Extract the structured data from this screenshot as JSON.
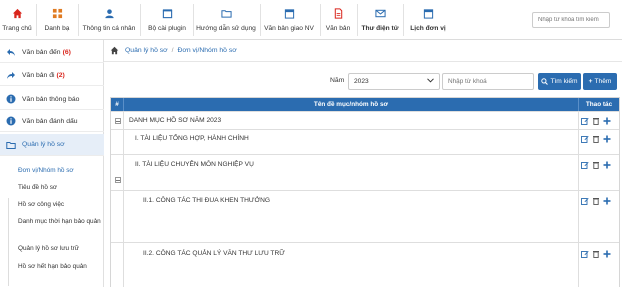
{
  "nav": {
    "items": [
      {
        "label": "Trang chủ",
        "icon": "home-icon"
      },
      {
        "label": "Danh bạ",
        "icon": "grid-icon"
      },
      {
        "label": "Thông tin cá nhân",
        "icon": "user-icon"
      },
      {
        "label": "Bộ cài plugin",
        "icon": "box-icon"
      },
      {
        "label": "Hướng dẫn sử dụng",
        "icon": "folder-icon"
      },
      {
        "label": "Văn bản giao NV",
        "icon": "calendar-icon"
      },
      {
        "label": "Văn bản",
        "icon": "document-icon"
      },
      {
        "label": "Thư điện tử",
        "icon": "mail-icon"
      },
      {
        "label": "Lịch đơn vị",
        "icon": "calendar-icon"
      }
    ],
    "search_placeholder": "Nhập từ khóa tìm kiếm"
  },
  "sidebar": {
    "items": [
      {
        "label": "Văn bản đến",
        "count": "(6)",
        "icon": "reply-icon"
      },
      {
        "label": "Văn bản đi",
        "count": "(2)",
        "icon": "forward-icon"
      },
      {
        "label": "Văn bản thông báo",
        "count": "",
        "icon": "info-icon"
      },
      {
        "label": "Văn bản đánh dấu",
        "count": "",
        "icon": "info-icon"
      },
      {
        "label": "Quản lý hồ sơ",
        "count": "",
        "icon": "folder-icon"
      }
    ],
    "sub_items": [
      "Đơn vị/Nhóm hồ sơ",
      "Tiêu đề hồ sơ",
      "Hồ sơ công việc",
      "Danh mục thời hạn bảo quản",
      "Quản lý hồ sơ lưu trữ",
      "Hồ sơ hết hạn bảo quản"
    ]
  },
  "breadcrumb": [
    "Quản lý hồ sơ",
    "Đơn vị/Nhóm hồ sơ"
  ],
  "filter": {
    "year_label": "Năm",
    "year_value": "2023",
    "keyword_placeholder": "Nhập từ khoá",
    "search_button": "Tìm kiếm",
    "add_button": "Thêm"
  },
  "table": {
    "headers": [
      "#",
      "Tên đề mục/nhóm hồ sơ",
      "Thao tác"
    ],
    "rows": [
      {
        "title": "DANH MỤC HỒ SƠ NĂM 2023",
        "collapsible": true
      },
      {
        "title": "I. TÀI LIỆU TỔNG HỢP, HÀNH CHÍNH",
        "collapsible": false
      },
      {
        "title": "II. TÀI LIỆU CHUYÊN MÔN NGHIỆP VỤ",
        "collapsible": true
      },
      {
        "title": "II.1. CÔNG TÁC THI ĐUA KHEN THƯỞNG",
        "collapsible": false
      },
      {
        "title": "II.2. CÔNG TÁC QUẢN LÝ VĂN THƯ LƯU TRỮ",
        "collapsible": false
      }
    ]
  },
  "colors": {
    "accent": "#2b6cb0",
    "home_red": "#d9251c",
    "count_red": "#d9251c"
  }
}
